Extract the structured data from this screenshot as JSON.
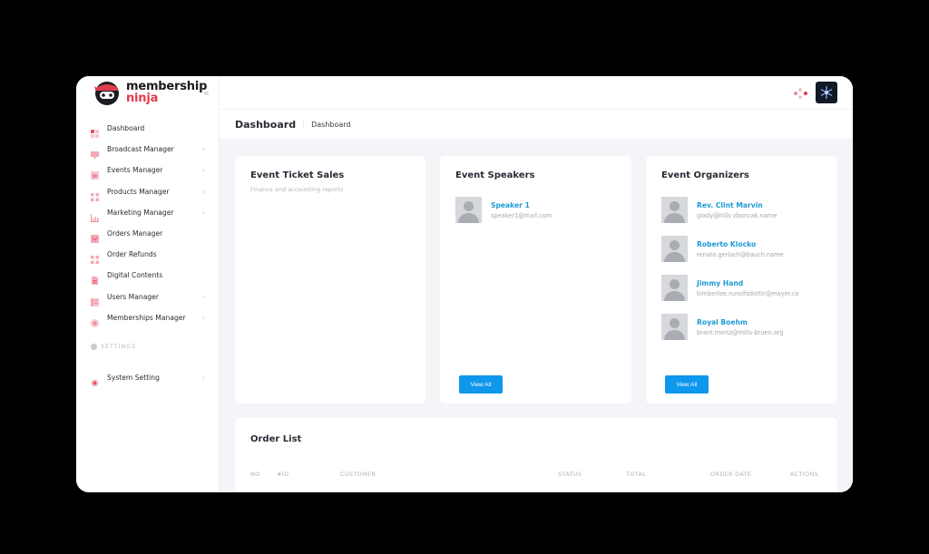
{
  "brand": {
    "line1": "membership",
    "line2": "ninja",
    "accent": "#e03c4d"
  },
  "sidebar": {
    "collapse_icon": "chevron-double-left-icon",
    "items": [
      {
        "label": "Dashboard",
        "icon": "dashboard-icon",
        "has_children": false
      },
      {
        "label": "Broadcast Manager",
        "icon": "broadcast-icon",
        "has_children": true
      },
      {
        "label": "Events Manager",
        "icon": "events-icon",
        "has_children": true
      },
      {
        "label": "Products Manager",
        "icon": "products-icon",
        "has_children": true
      },
      {
        "label": "Marketing Manager",
        "icon": "marketing-icon",
        "has_children": true
      },
      {
        "label": "Orders Manager",
        "icon": "orders-icon",
        "has_children": false
      },
      {
        "label": "Order Refunds",
        "icon": "refunds-icon",
        "has_children": false
      },
      {
        "label": "Digital Contents",
        "icon": "document-icon",
        "has_children": false
      },
      {
        "label": "Users Manager",
        "icon": "users-icon",
        "has_children": true
      },
      {
        "label": "Memberships Manager",
        "icon": "membership-icon",
        "has_children": true
      }
    ],
    "settings_heading": "SETTINGS",
    "system_setting": {
      "label": "System Setting",
      "icon": "gear-icon",
      "has_children": true
    },
    "chevron": "›"
  },
  "header": {
    "title": "Dashboard",
    "breadcrumb": "Dashboard"
  },
  "ticket_sales": {
    "title": "Event Ticket Sales",
    "subtitle": "Finance and accounting reports"
  },
  "speakers": {
    "title": "Event Speakers",
    "people": [
      {
        "name": "Speaker 1",
        "email": "speaker1@mail.com"
      }
    ],
    "button": "View All"
  },
  "organizers": {
    "title": "Event Organizers",
    "people": [
      {
        "name": "Rev. Clint Marvin",
        "email": "glady@hills-zboncak.name"
      },
      {
        "name": "Roberto Klocko",
        "email": "renato.gerlach@bauch.name"
      },
      {
        "name": "Jimmy Hand",
        "email": "kimberlee.runolfsdottir@mayer.co"
      },
      {
        "name": "Royal Boehm",
        "email": "brant.mertz@mills-bruen.org"
      }
    ],
    "button": "View All"
  },
  "orders": {
    "title": "Order List",
    "columns": [
      "NO",
      "#ID",
      "CUSTOMER",
      "STATUS",
      "TOTAL",
      "ORDER DATE",
      "ACTIONS"
    ]
  },
  "colors": {
    "link": "#1e9ad6",
    "primary_button": "#0e97ec",
    "nav_icon": "#f2a3b0"
  }
}
